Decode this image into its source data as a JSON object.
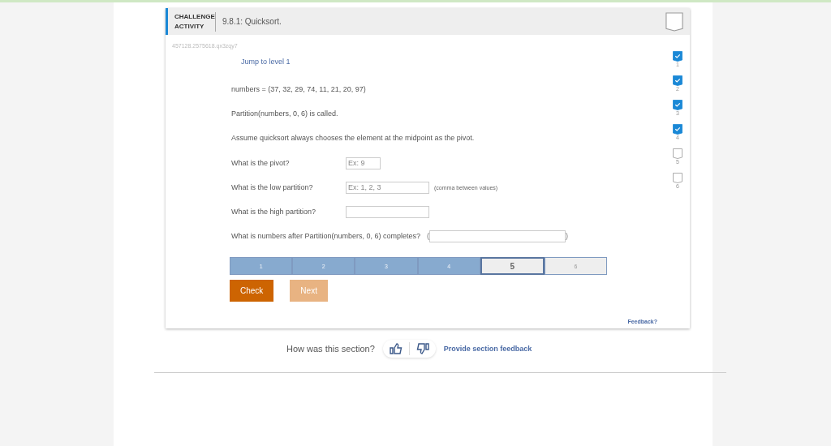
{
  "activity": {
    "type_label": "CHALLENGE ACTIVITY",
    "title": "9.8.1: Quicksort.",
    "completed": false,
    "code": "457128.2575618.qx3zqy7"
  },
  "jump_link": "Jump to level 1",
  "statements": [
    "numbers = (37, 32, 29, 74, 11, 21, 20, 97)",
    "Partition(numbers, 0, 6) is called.",
    "Assume quicksort always chooses the element at the midpoint as the pivot."
  ],
  "questions": [
    {
      "label": "What is the pivot?",
      "placeholder": "Ex: 9",
      "kind": "short"
    },
    {
      "label": "What is the low partition?",
      "placeholder": "Ex: 1, 2, 3",
      "kind": "medium",
      "note": "(comma between values)"
    },
    {
      "label": "What is the high partition?",
      "kind": "medium"
    },
    {
      "label": "What is numbers after Partition(numbers, 0, 6) completes?",
      "kind": "inline",
      "open": "(",
      "close": ")"
    }
  ],
  "progress": [
    {
      "label": "1",
      "completed": true,
      "selected": false
    },
    {
      "label": "2",
      "completed": true,
      "selected": false
    },
    {
      "label": "3",
      "completed": true,
      "selected": false
    },
    {
      "label": "4",
      "completed": true,
      "selected": false
    },
    {
      "label": "5",
      "completed": false,
      "selected": true
    },
    {
      "label": "6",
      "completed": false,
      "selected": false
    }
  ],
  "buttons": [
    {
      "label": "Check",
      "disabled": false
    },
    {
      "label": "Next",
      "disabled": true
    }
  ],
  "levels": [
    {
      "label": "1",
      "checked": true
    },
    {
      "label": "2",
      "checked": true
    },
    {
      "label": "3",
      "checked": true
    },
    {
      "label": "4",
      "checked": true
    },
    {
      "label": "5",
      "checked": false
    },
    {
      "label": "6",
      "checked": false
    }
  ],
  "feedback_link": "Feedback?",
  "section_feedback": {
    "question": "How was this section?",
    "link": "Provide section feedback"
  }
}
